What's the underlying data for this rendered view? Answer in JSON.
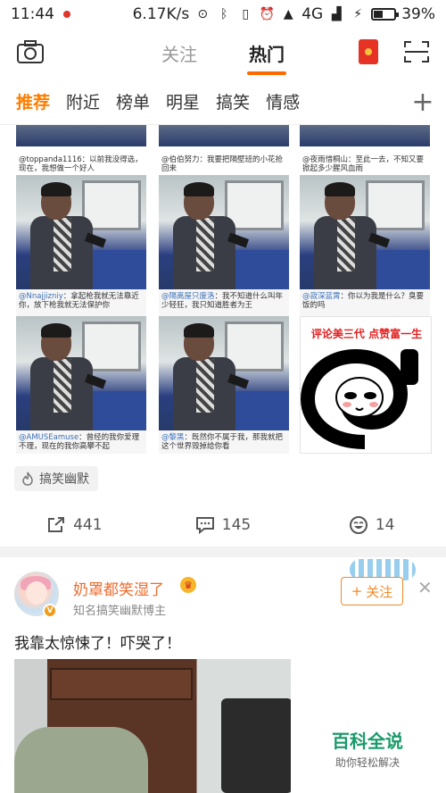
{
  "status_bar": {
    "time": "11:44",
    "network_speed": "6.17K/s",
    "signal": "4G",
    "battery": "39%"
  },
  "top_nav": {
    "tab_follow": "关注",
    "tab_hot": "热门",
    "icons": [
      "camera-icon",
      "red-packet-icon",
      "scan-icon"
    ]
  },
  "channels": {
    "items": [
      "推荐",
      "附近",
      "榜单",
      "明星",
      "搞笑",
      "情感"
    ],
    "active": "推荐",
    "plus": "+"
  },
  "grid": {
    "top_captions": [
      {
        "user": "@toppanda1116",
        "text": "：以前我没得选，现在，我想做一个好人"
      },
      {
        "user": "@伯伯努力",
        "text": "：我要把隔壁班的小花抢回来"
      },
      {
        "user": "@夜雨惜桐山",
        "text": "：至此一去，不知又要掀起多少腥风血雨"
      }
    ],
    "captions": [
      {
        "user": "@Nnajjizniy",
        "text": "：拿起枪我就无法靠近你，放下枪我就无法保护你"
      },
      {
        "user": "@隔离屋只废洛",
        "text": "：我不知道什么叫年少轻狂，我只知道胜者为王"
      },
      {
        "user": "@寂深蓝霄",
        "text": "：你以为我是什么？臭要饭的吗"
      },
      {
        "user": "@AMUSEamuse",
        "text": "：曾经的我你爱理不理，现在的我你高攀不起"
      },
      {
        "user": "@黎黑",
        "text": "：既然你不属于我，那我就把这个世界毁掉给你看"
      }
    ],
    "meme_title": "评论美三代 点赞富一生"
  },
  "tag": {
    "label": "搞笑幽默"
  },
  "actions": {
    "repost_count": "441",
    "comment_count": "145",
    "like_count": "14"
  },
  "post2": {
    "username": "奶罩都笑湿了",
    "description": "知名搞笑幽默博主",
    "follow_label": "关注",
    "follow_plus": "+",
    "text": "我靠太惊悚了！吓哭了！",
    "v_badge": "V"
  },
  "watermark": {
    "title": "百科全说",
    "subtitle": "助你轻松解决"
  },
  "colors": {
    "accent": "#ff7d00",
    "username": "#f06b2c",
    "follow": "#f08a2a"
  }
}
